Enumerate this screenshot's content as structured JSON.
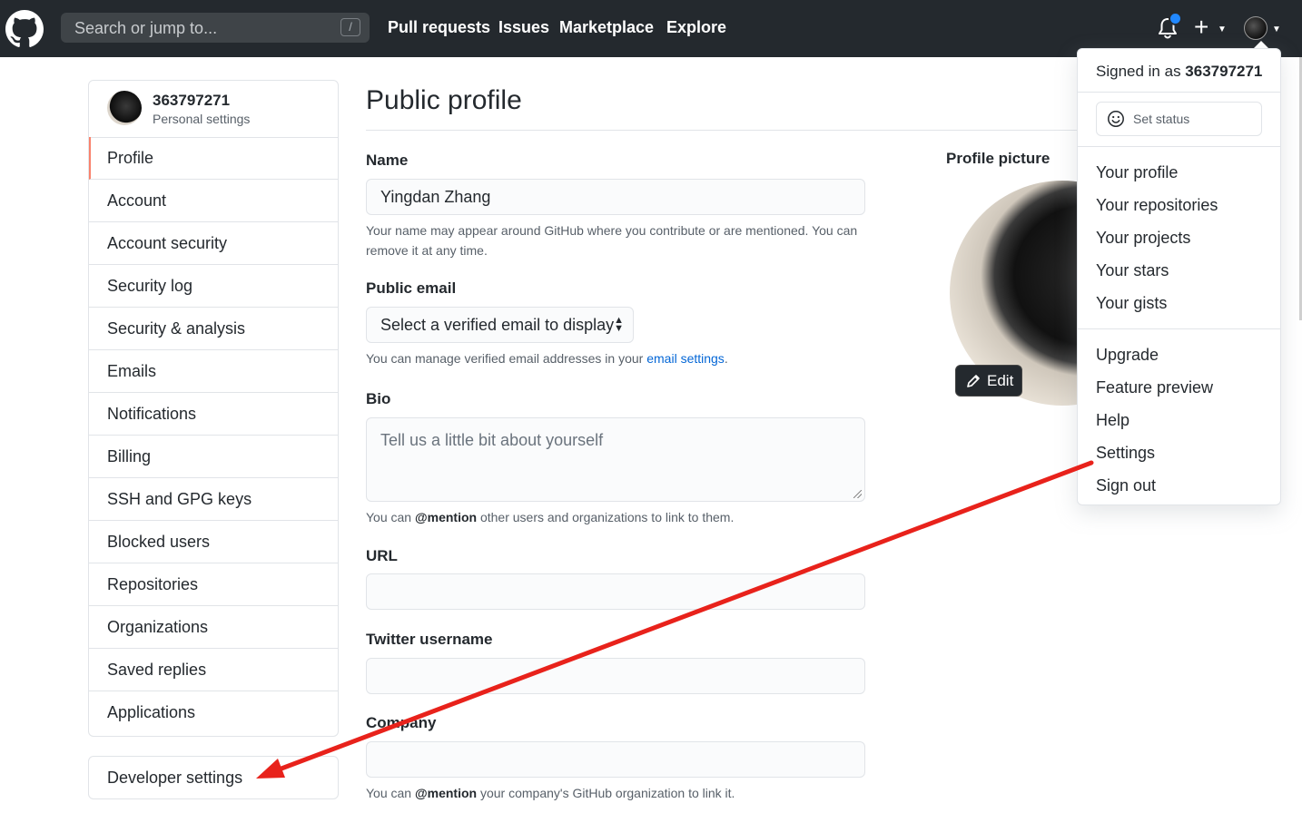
{
  "header": {
    "search_placeholder": "Search or jump to...",
    "search_shortcut": "/",
    "nav": [
      "Pull requests",
      "Issues",
      "Marketplace",
      "Explore"
    ]
  },
  "sidebar": {
    "username": "363797271",
    "subtitle": "Personal settings",
    "items": [
      {
        "label": "Profile",
        "active": true
      },
      {
        "label": "Account"
      },
      {
        "label": "Account security"
      },
      {
        "label": "Security log"
      },
      {
        "label": "Security & analysis"
      },
      {
        "label": "Emails"
      },
      {
        "label": "Notifications"
      },
      {
        "label": "Billing"
      },
      {
        "label": "SSH and GPG keys"
      },
      {
        "label": "Blocked users"
      },
      {
        "label": "Repositories"
      },
      {
        "label": "Organizations"
      },
      {
        "label": "Saved replies"
      },
      {
        "label": "Applications"
      }
    ],
    "developer_settings": "Developer settings"
  },
  "main": {
    "title": "Public profile",
    "name": {
      "label": "Name",
      "value": "Yingdan Zhang",
      "note": "Your name may appear around GitHub where you contribute or are mentioned. You can remove it at any time."
    },
    "public_email": {
      "label": "Public email",
      "selected": "Select a verified email to display",
      "note_before": "You can manage verified email addresses in your ",
      "note_link": "email settings",
      "note_after": "."
    },
    "bio": {
      "label": "Bio",
      "placeholder": "Tell us a little bit about yourself",
      "note_before": "You can ",
      "note_bold": "@mention",
      "note_after": " other users and organizations to link to them."
    },
    "url": {
      "label": "URL",
      "value": ""
    },
    "twitter": {
      "label": "Twitter username",
      "value": ""
    },
    "company": {
      "label": "Company",
      "value": "",
      "note_before": "You can ",
      "note_bold": "@mention",
      "note_after": " your company's GitHub organization to link it."
    },
    "profile_picture": {
      "label": "Profile picture",
      "edit": "Edit"
    }
  },
  "dropdown": {
    "signed_in_prefix": "Signed in as ",
    "username": "363797271",
    "set_status": "Set status",
    "group1": [
      "Your profile",
      "Your repositories",
      "Your projects",
      "Your stars",
      "Your gists"
    ],
    "group2": [
      "Upgrade",
      "Feature preview",
      "Help",
      "Settings",
      "Sign out"
    ]
  },
  "colors": {
    "header_bg": "#24292e",
    "active_marker": "#f9826c",
    "link": "#0366d6",
    "notification_dot": "#2188ff",
    "annotation_arrow": "#e8221b"
  },
  "icons": [
    "github-logo-icon",
    "bell-icon",
    "plus-icon",
    "caret-down-icon",
    "smiley-icon",
    "pencil-icon",
    "select-arrows-icon"
  ]
}
